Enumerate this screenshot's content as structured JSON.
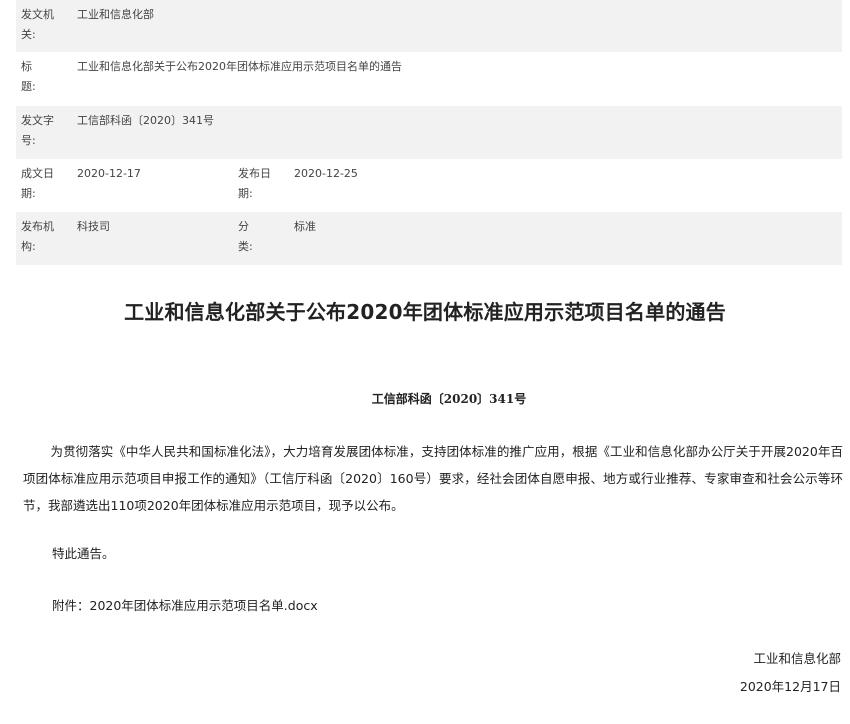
{
  "meta": {
    "issuer_label": "发文机关:",
    "issuer_value": "工业和信息化部",
    "title_label": "标　　题:",
    "title_value": "工业和信息化部关于公布2020年团体标准应用示范项目名单的通告",
    "docno_label": "发文字号:",
    "docno_value": "工信部科函〔2020〕341号",
    "written_label": "成文日期:",
    "written_value": "2020-12-17",
    "published_label": "发布日期:",
    "published_value": "2020-12-25",
    "publisher_label": "发布机构:",
    "publisher_value": "科技司",
    "category_label": "分　　类:",
    "category_value": "标准"
  },
  "document": {
    "headline": "工业和信息化部关于公布2020年团体标准应用示范项目名单的通告",
    "doc_number": "工信部科函〔2020〕341号",
    "body": "为贯彻落实《中华人民共和国标准化法》，大力培育发展团体标准，支持团体标准的推广应用，根据《工业和信息化部办公厅关于开展2020年百项团体标准应用示范项目申报工作的通知》（工信厅科函〔2020〕160号）要求，经社会团体自愿申报、地方或行业推荐、专家审查和社会公示等环节，我部遴选出110项2020年团体标准应用示范项目，现予以公布。",
    "special_notice": "特此通告。",
    "attachment": "附件：2020年团体标准应用示范项目名单.docx",
    "sign_org": "工业和信息化部",
    "sign_date": "2020年12月17日"
  }
}
